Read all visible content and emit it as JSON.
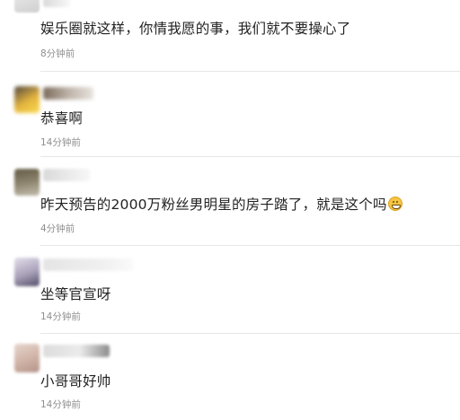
{
  "comments": [
    {
      "text": "娱乐圈就这样，你情我愿的事，我们就不要操心了",
      "time": "8分钟前"
    },
    {
      "text": "恭喜啊",
      "time": "14分钟前"
    },
    {
      "text": "昨天预告的2000万粉丝男明星的房子踏了，就是这个吗",
      "time": "4分钟前",
      "emoji": "grinning-face-emoji"
    },
    {
      "text": "坐等官宣呀",
      "time": "14分钟前"
    },
    {
      "text": "小哥哥好帅",
      "time": "14分钟前"
    }
  ],
  "colors": {
    "text": "#222222",
    "time": "#8f8f8f",
    "divider": "#e7e7e7"
  }
}
